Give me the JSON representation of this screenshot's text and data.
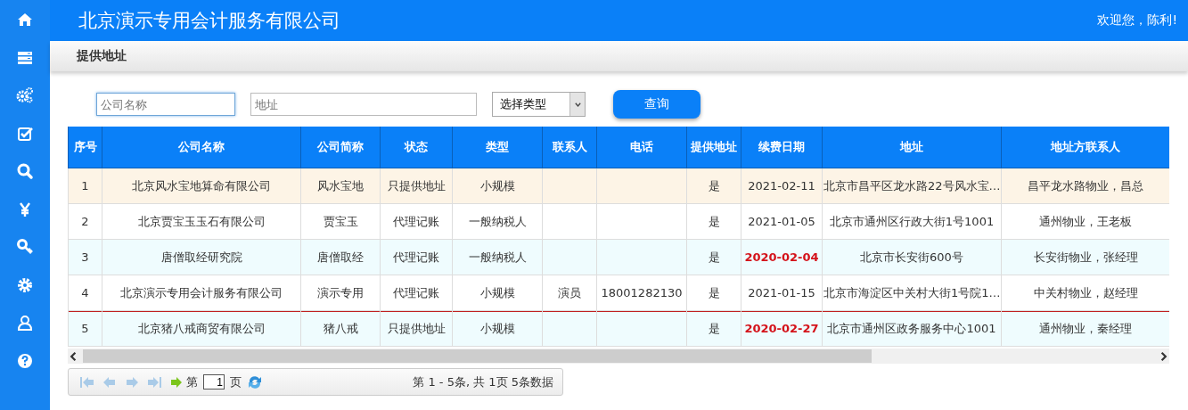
{
  "header": {
    "title": "北京演示专用会计服务有限公司",
    "welcome": "欢迎您，陈利!"
  },
  "breadcrumb": "提供地址",
  "filters": {
    "company": {
      "placeholder": "公司名称",
      "focused": true
    },
    "address": {
      "placeholder": "地址",
      "focused": false
    },
    "type_select": {
      "value": "选择类型"
    },
    "search_button": "查询"
  },
  "table": {
    "columns": [
      "序号",
      "公司名称",
      "公司简称",
      "状态",
      "类型",
      "联系人",
      "电话",
      "提供地址",
      "续费日期",
      "地址",
      "地址方联系人"
    ],
    "rows": [
      {
        "selected": true,
        "marked": false,
        "expired": false,
        "cells": [
          "1",
          "北京风水宝地算命有限公司",
          "风水宝地",
          "只提供地址",
          "小规模",
          "",
          "",
          "是",
          "2021-02-11",
          "北京市昌平区龙水路22号风水宝…",
          "昌平龙水路物业，昌总"
        ]
      },
      {
        "selected": false,
        "marked": false,
        "expired": false,
        "cells": [
          "2",
          "北京贾宝玉玉石有限公司",
          "贾宝玉",
          "代理记账",
          "一般纳税人",
          "",
          "",
          "是",
          "2021-01-05",
          "北京市通州区行政大街1号1001",
          "通州物业，王老板"
        ]
      },
      {
        "selected": false,
        "marked": false,
        "expired": true,
        "cells": [
          "3",
          "唐僧取经研究院",
          "唐僧取经",
          "代理记账",
          "一般纳税人",
          "",
          "",
          "是",
          "2020-02-04",
          "北京市长安街600号",
          "长安街物业，张经理"
        ]
      },
      {
        "selected": false,
        "marked": false,
        "expired": false,
        "cells": [
          "4",
          "北京演示专用会计服务有限公司",
          "演示专用",
          "代理记账",
          "小规模",
          "演员",
          "18001282130",
          "是",
          "2021-01-15",
          "北京市海淀区中关村大街1号院1…",
          "中关村物业，赵经理"
        ]
      },
      {
        "selected": false,
        "marked": true,
        "expired": true,
        "cells": [
          "5",
          "北京猪八戒商贸有限公司",
          "猪八戒",
          "只提供地址",
          "小规模",
          "",
          "",
          "是",
          "2020-02-27",
          "北京市通州区政务服务中心1001",
          "通州物业，秦经理"
        ]
      }
    ]
  },
  "pager": {
    "page_prefix": "第",
    "page": "1",
    "page_suffix": "页",
    "summary": "第 1 - 5条, 共 1页 5条数据"
  }
}
